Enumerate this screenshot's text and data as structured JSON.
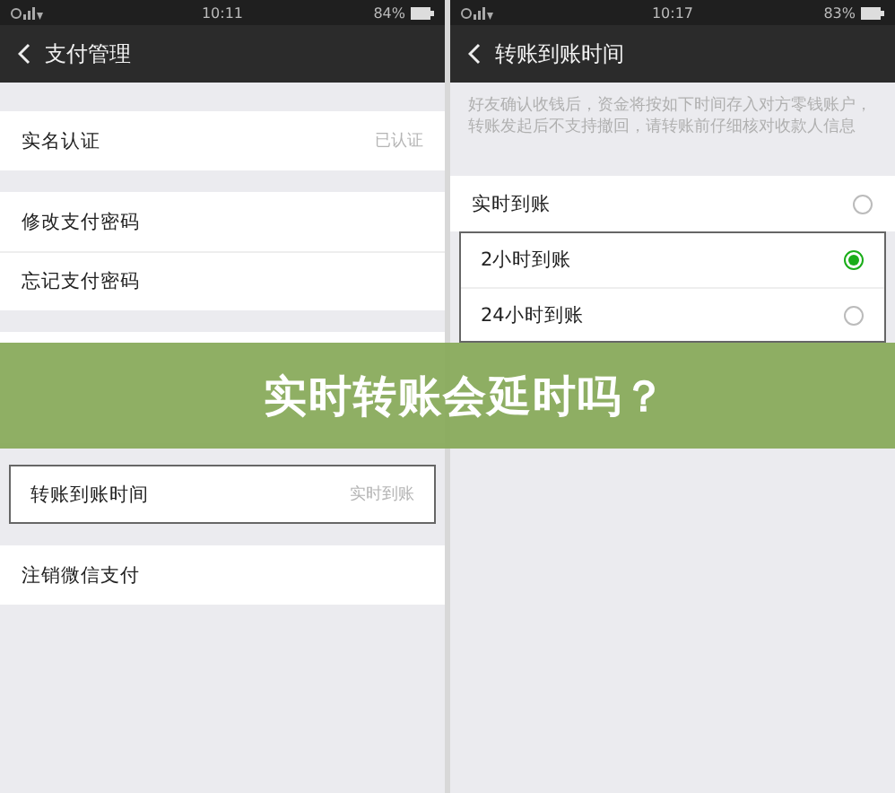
{
  "screens": [
    {
      "status": {
        "time": "10:11",
        "battery": "84%"
      },
      "title": "支付管理",
      "sections": [
        {
          "kind": "group",
          "highlighted": false,
          "rows": [
            {
              "kind": "link",
              "label": "实名认证",
              "value": "已认证"
            }
          ]
        },
        {
          "kind": "group",
          "highlighted": false,
          "rows": [
            {
              "kind": "link",
              "label": "修改支付密码"
            },
            {
              "kind": "link",
              "label": "忘记支付密码"
            }
          ]
        },
        {
          "kind": "covered"
        },
        {
          "kind": "group",
          "highlighted": true,
          "rows": [
            {
              "kind": "link",
              "label": "转账到账时间",
              "value": "实时到账"
            }
          ]
        },
        {
          "kind": "group",
          "highlighted": false,
          "rows": [
            {
              "kind": "link",
              "label": "注销微信支付"
            }
          ]
        }
      ]
    },
    {
      "status": {
        "time": "10:17",
        "battery": "83%"
      },
      "title": "转账到账时间",
      "sections": [
        {
          "kind": "notice",
          "text": "好友确认收钱后，资金将按如下时间存入对方零钱账户，转账发起后不支持撤回，请转账前仔细核对收款人信息"
        },
        {
          "kind": "group",
          "highlighted": false,
          "rows": [
            {
              "kind": "radio",
              "label": "实时到账",
              "selected": false
            }
          ]
        },
        {
          "kind": "group",
          "highlighted": true,
          "rows": [
            {
              "kind": "radio",
              "label": "2小时到账",
              "selected": true
            },
            {
              "kind": "radio",
              "label": "24小时到账",
              "selected": false
            }
          ]
        }
      ]
    }
  ],
  "banner": {
    "title": "实时转账会延时吗？"
  }
}
